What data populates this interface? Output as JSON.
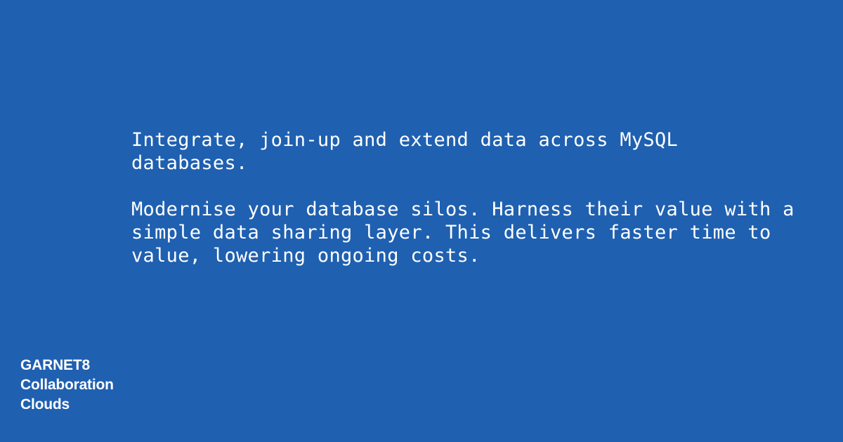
{
  "headline": "Integrate, join-up and extend data across MySQL databases.",
  "description": "Modernise your database silos. Harness their value with a simple data sharing layer. This delivers faster time to value, lowering ongoing costs.",
  "brand": {
    "lines": [
      "GARNET8",
      "Collaboration",
      "Clouds"
    ]
  },
  "colors": {
    "background": "#1f60b0",
    "text": "#ffffff"
  }
}
